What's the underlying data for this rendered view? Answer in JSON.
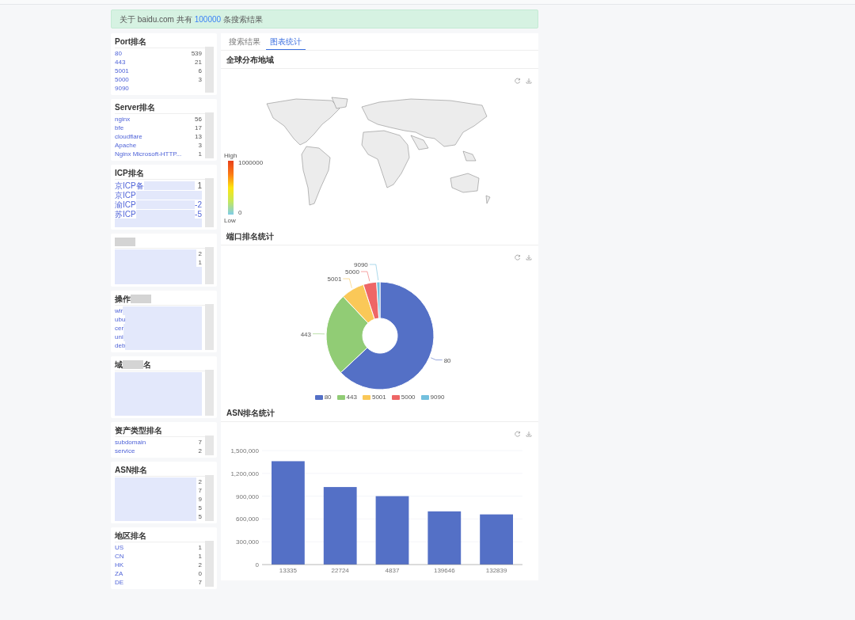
{
  "top_alert": {
    "prefix": "关于 baidu.com 共有",
    "count": "100000",
    "suffix": "条搜索结果"
  },
  "sidebar": [
    {
      "title": "Port排名",
      "title_blur": false,
      "items": [
        {
          "label": "80",
          "count": "539",
          "blur": false
        },
        {
          "label": "443",
          "count": "21",
          "blur": false
        },
        {
          "label": "5001",
          "count": "6",
          "blur": false
        },
        {
          "label": "5000",
          "count": "3",
          "blur": false
        },
        {
          "label": "9090",
          "blur": false
        }
      ]
    },
    {
      "title": "Server排名",
      "title_blur": false,
      "items": [
        {
          "label": "nginx",
          "count": "56",
          "blur": false
        },
        {
          "label": "bfe",
          "count": "17",
          "blur": false
        },
        {
          "label": "cloudflare",
          "count": "13",
          "blur": false
        },
        {
          "label": "Apache",
          "count": "3",
          "blur": false
        },
        {
          "label": "Nginx Microsoft-HTTP...",
          "count": "1",
          "blur": false
        }
      ]
    },
    {
      "title": "ICP排名",
      "title_blur": false,
      "items": [
        {
          "label": "京ICP备",
          "count": "1",
          "blur": true
        },
        {
          "label": "京ICP",
          "blur": true
        },
        {
          "label": "渝ICP",
          "tail": "-2",
          "blur": true
        },
        {
          "label": "苏ICP",
          "tail": "-5",
          "blur": true
        },
        {
          "blur": true
        }
      ]
    },
    {
      "title_blur": true,
      "items": [
        {
          "count": "2",
          "blur": true
        },
        {
          "count": "1",
          "blur": true
        },
        {
          "blur": true
        },
        {
          "blur": true
        }
      ]
    },
    {
      "title": "操作",
      "title_blur": true,
      "items": [
        {
          "label": "wir",
          "blur": true
        },
        {
          "label": "ubu",
          "blur": true
        },
        {
          "label": "cer",
          "blur": true
        },
        {
          "label": "uni",
          "blur": true
        },
        {
          "label": "deb",
          "blur": true
        }
      ]
    },
    {
      "title": "域",
      "title_tail": "名",
      "title_blur": true,
      "items": [
        {
          "blur": true
        },
        {
          "blur": true
        },
        {
          "blur": true
        },
        {
          "blur": true
        },
        {
          "blur": true
        }
      ]
    },
    {
      "title": "资产类型排名",
      "title_blur": false,
      "items": [
        {
          "label": "subdomain",
          "count": "7",
          "blur": false
        },
        {
          "label": "service",
          "count": "2",
          "blur": false
        }
      ]
    },
    {
      "title": "ASN排名",
      "title_blur": false,
      "items": [
        {
          "count": "2",
          "blur": true
        },
        {
          "count": "7",
          "blur": true
        },
        {
          "count": "9",
          "blur": true
        },
        {
          "count": "5",
          "blur": true
        },
        {
          "count": "5",
          "blur": true
        }
      ]
    },
    {
      "title": "地区排名",
      "title_blur": false,
      "items": [
        {
          "label": "US",
          "count": "1",
          "blur": false
        },
        {
          "label": "CN",
          "count": "1",
          "blur": false
        },
        {
          "label": "HK",
          "count": "2",
          "blur": false
        },
        {
          "label": "ZA",
          "count": "0",
          "blur": false
        },
        {
          "label": "DE",
          "count": "7",
          "blur": false
        }
      ]
    }
  ],
  "tabs": [
    {
      "label": "搜索结果",
      "selected": false
    },
    {
      "label": "图表统计",
      "selected": true
    }
  ],
  "sections": [
    {
      "kind": "map",
      "title": "全球分布地域",
      "legend": {
        "high": "High",
        "max": "1000000",
        "min": "0",
        "low": "Low"
      }
    },
    {
      "kind": "donut",
      "title": "端口排名统计",
      "chart_data": {
        "type": "donut",
        "categories": [
          "80",
          "443",
          "5001",
          "5000",
          "9090"
        ],
        "series": [
          {
            "values": [
              63,
              25,
              7,
              4,
              1
            ]
          }
        ],
        "colors": [
          "#5470c6",
          "#91cc75",
          "#fac858",
          "#ee6666",
          "#73c0de"
        ],
        "legend": true
      }
    },
    {
      "kind": "bar",
      "title": "ASN排名统计",
      "chart_data": {
        "type": "bar",
        "categories": [
          "13335",
          "22724",
          "4837",
          "139646",
          "132839"
        ],
        "series": [
          {
            "color": "#5470c6",
            "values": [
              1360000,
              1020000,
              900000,
              700000,
              660000
            ]
          }
        ],
        "ylim": [
          0,
          1500000
        ],
        "grid": true,
        "yticks": [
          {
            "value": 0,
            "label": "0"
          },
          {
            "value": 300000,
            "label": "300,000"
          },
          {
            "value": 600000,
            "label": "600,000"
          },
          {
            "value": 900000,
            "label": "900,000"
          },
          {
            "value": 1200000,
            "label": "1,200,000"
          },
          {
            "value": 1500000,
            "label": "1,500,000"
          }
        ]
      }
    }
  ]
}
